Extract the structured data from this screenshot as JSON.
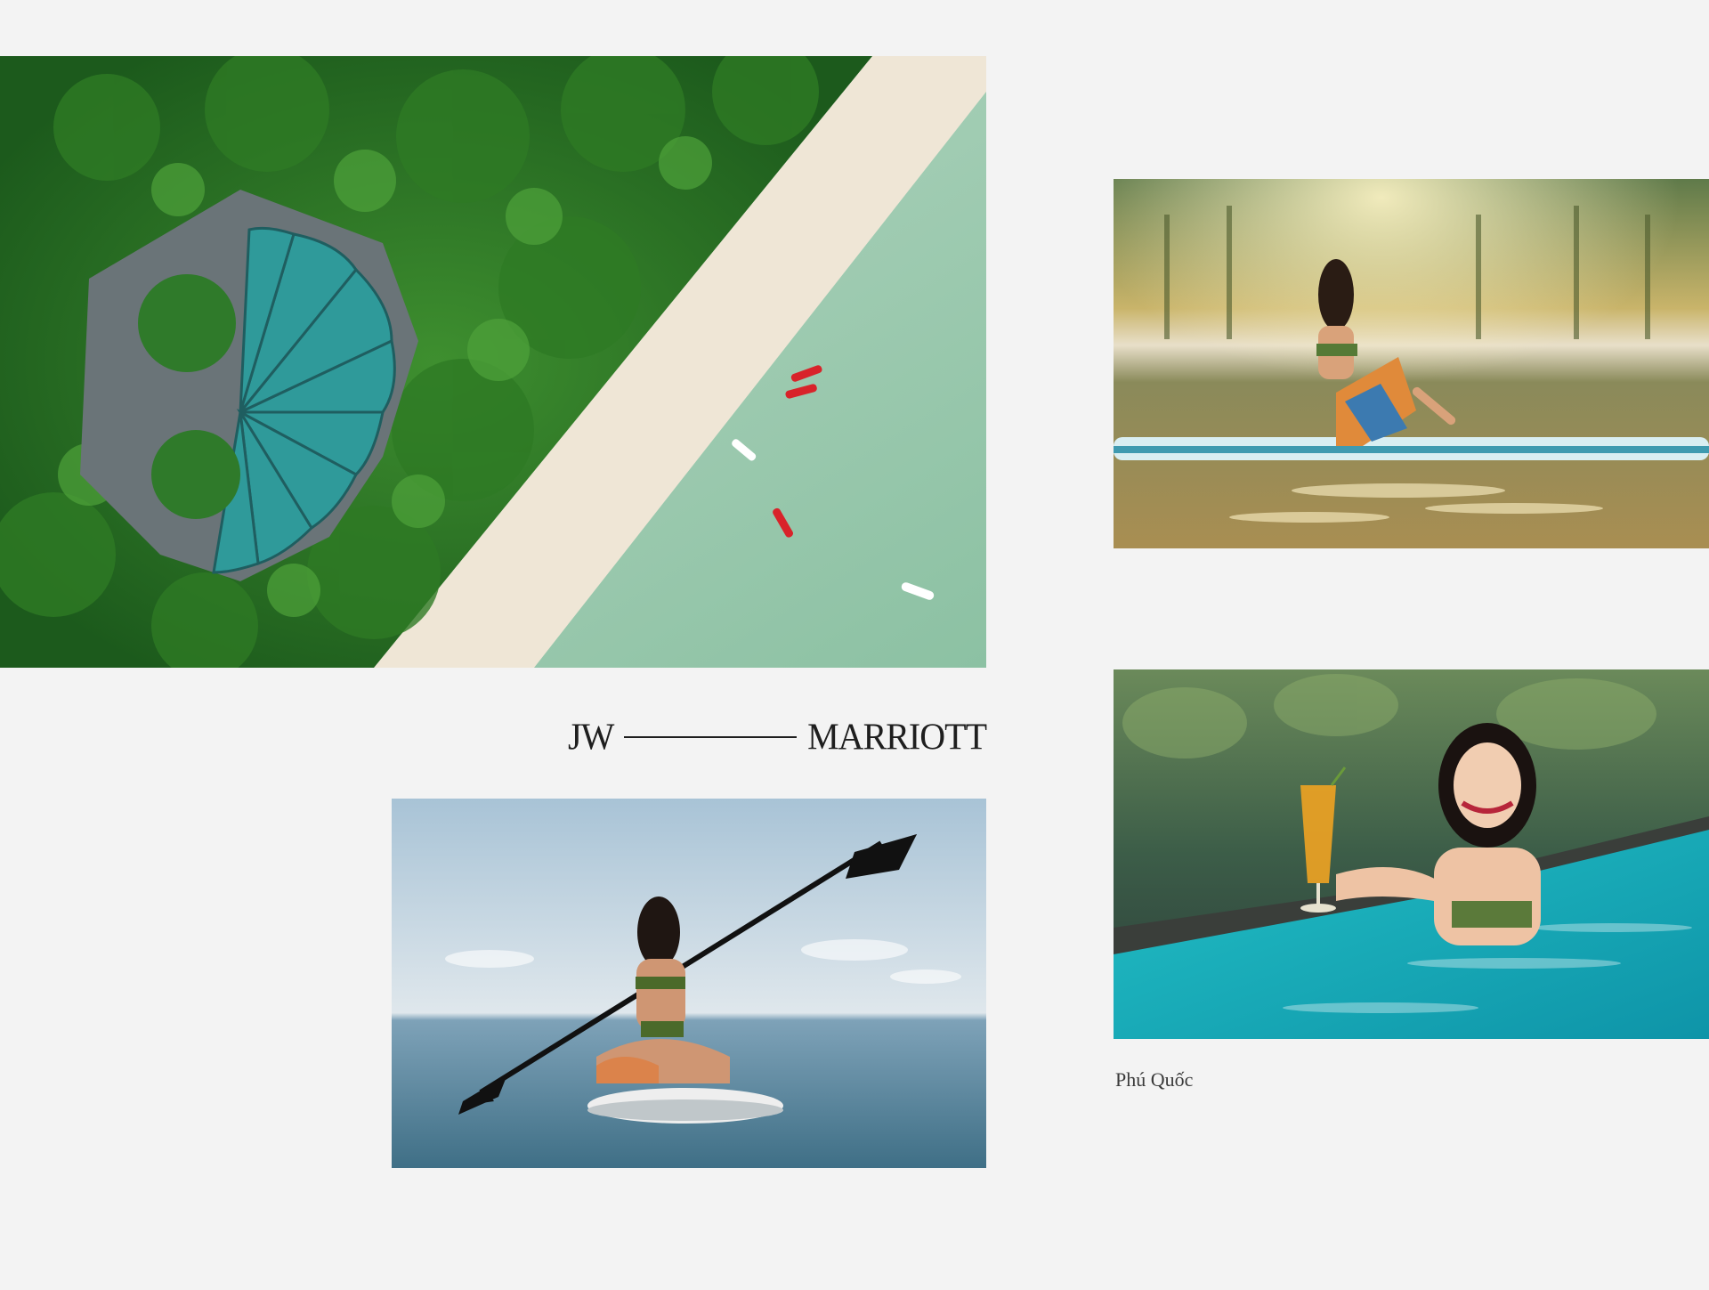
{
  "brand": {
    "left_word": "JW",
    "right_word": "MARRIOTT"
  },
  "caption": "Phú Quốc",
  "photos": {
    "aerial": "aerial-resort-beach-photo",
    "sup": "paddleboard-sunset-photo",
    "kayak": "kayak-paddle-photo",
    "pool": "pool-cocktail-photo"
  },
  "colors": {
    "background": "#f3f3f3",
    "text": "#1e1e1e"
  }
}
